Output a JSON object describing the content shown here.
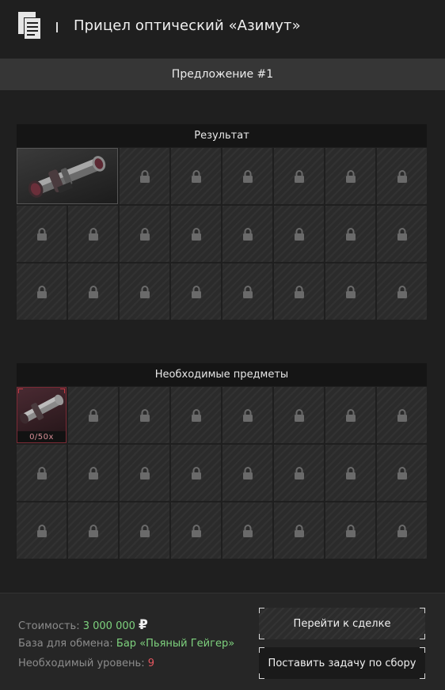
{
  "header": {
    "title": "Прицел оптический «Азимут»",
    "icon": "documents-icon"
  },
  "offer": {
    "label": "Предложение #1"
  },
  "result": {
    "title": "Результат",
    "item_name": "Прицел оптический «Азимут»",
    "item_icon": "scope-icon"
  },
  "required": {
    "title": "Необходимые предметы",
    "item_icon": "scope-icon",
    "quantity": "0/50x"
  },
  "footer": {
    "cost_label": "Стоимость:",
    "cost_value": "3 000 000",
    "currency": "₽",
    "base_label": "База для обмена:",
    "base_value": "Бар «Пьяный Гейгер»",
    "level_label": "Необходимый уровень:",
    "level_value": "9",
    "go_to_deal": "Перейти к сделке",
    "set_task": "Поставить задачу по сбору"
  },
  "colors": {
    "accent_green": "#7ed27e",
    "accent_red": "#e2555e",
    "background": "#1f1f1f"
  }
}
